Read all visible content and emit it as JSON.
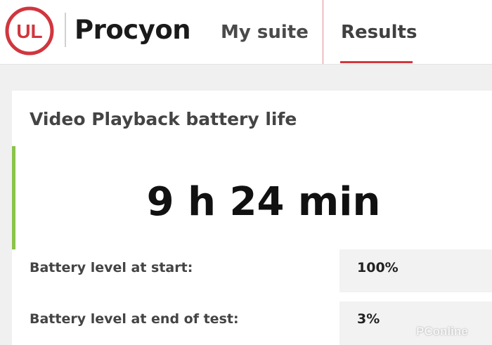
{
  "app": {
    "logo_text": "UL",
    "brand": "Procyon"
  },
  "nav": {
    "items": [
      {
        "label": "My suite",
        "active": false
      },
      {
        "label": "Results",
        "active": true
      }
    ]
  },
  "result_card": {
    "title": "Video Playback battery life",
    "value": "9 h 24 min",
    "rows": [
      {
        "label": "Battery level at start:",
        "value": "100%"
      },
      {
        "label": "Battery level at end of test:",
        "value": "3%"
      }
    ]
  },
  "watermark": "PConline",
  "colors": {
    "accent_red": "#d0363e",
    "accent_green": "#8bc34a"
  }
}
